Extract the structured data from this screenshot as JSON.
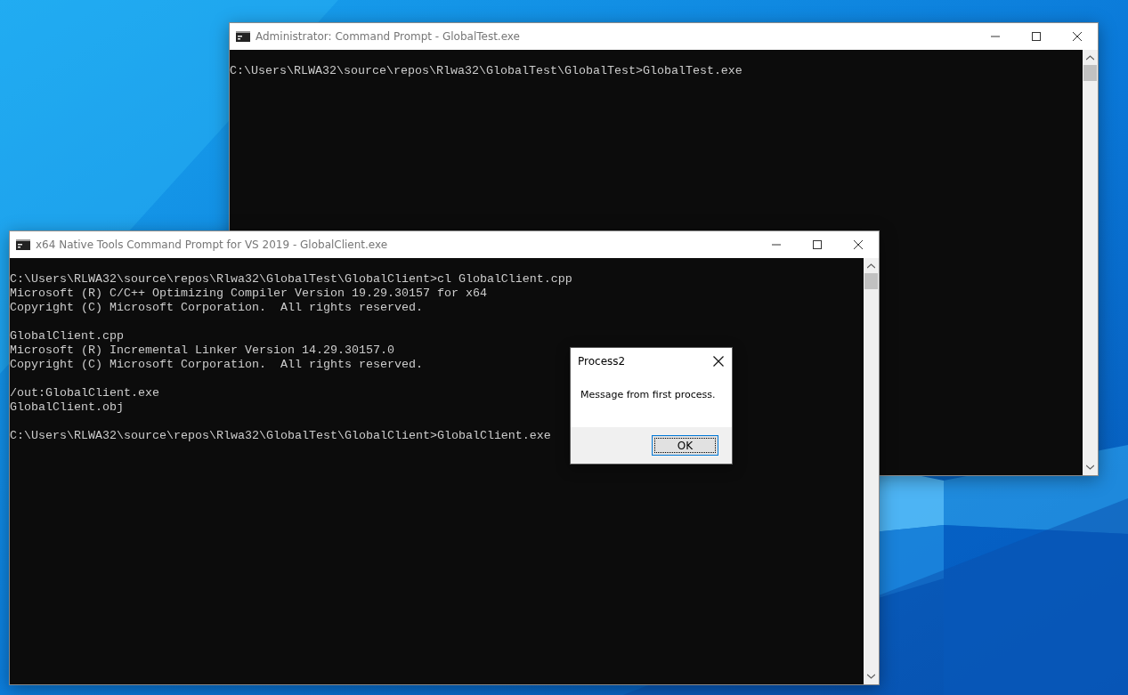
{
  "windows": [
    {
      "title": "Administrator: Command Prompt - GlobalTest.exe",
      "blocks": [
        [
          "C:\\Users\\RLWA32\\source\\repos\\Rlwa32\\GlobalTest\\GlobalTest>GlobalTest.exe"
        ]
      ]
    },
    {
      "title": "x64 Native Tools Command Prompt for VS 2019 - GlobalClient.exe",
      "blocks": [
        [
          "C:\\Users\\RLWA32\\source\\repos\\Rlwa32\\GlobalTest\\GlobalClient>cl GlobalClient.cpp",
          "Microsoft (R) C/C++ Optimizing Compiler Version 19.29.30157 for x64",
          "Copyright (C) Microsoft Corporation.  All rights reserved."
        ],
        [
          "GlobalClient.cpp",
          "Microsoft (R) Incremental Linker Version 14.29.30157.0",
          "Copyright (C) Microsoft Corporation.  All rights reserved."
        ],
        [
          "/out:GlobalClient.exe",
          "GlobalClient.obj"
        ],
        [
          "C:\\Users\\RLWA32\\source\\repos\\Rlwa32\\GlobalTest\\GlobalClient>GlobalClient.exe"
        ]
      ]
    }
  ],
  "dialog": {
    "title": "Process2",
    "message": "Message from first process.",
    "button": "OK"
  }
}
